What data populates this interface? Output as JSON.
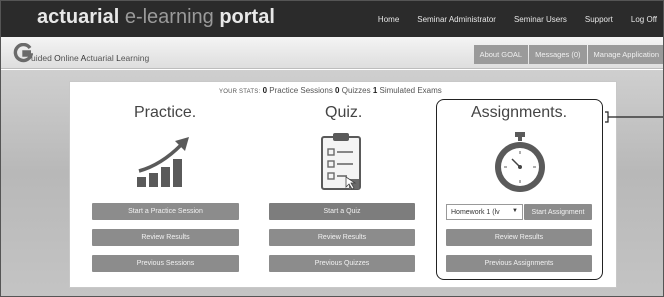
{
  "brand": {
    "part1": "actuarial",
    "part2": " e-learning ",
    "part3": "portal"
  },
  "top_nav": [
    "Home",
    "Seminar Administrator",
    "Seminar Users",
    "Support",
    "Log Off"
  ],
  "logo": {
    "letter": "G",
    "text_parts": [
      "uided ",
      "O",
      "nline ",
      "A",
      "ctuarial ",
      "L",
      "earning"
    ]
  },
  "sub_nav": [
    "About GOAL",
    "Messages (0)",
    "Manage Application"
  ],
  "stats": {
    "label": "YOUR STATS:",
    "sessions_count": "0",
    "sessions_label": " Practice Sessions ",
    "quizzes_count": "0",
    "quizzes_label": " Quizzes ",
    "exams_count": "1",
    "exams_label": " Simulated Exams"
  },
  "practice": {
    "title": "Practice.",
    "start_label": "Start a Practice Session",
    "review_label": "Review Results",
    "previous_label": "Previous Sessions",
    "icon": "rising-bar-chart-icon"
  },
  "quiz": {
    "title": "Quiz.",
    "start_label": "Start a Quiz",
    "review_label": "Review Results",
    "previous_label": "Previous Quizzes",
    "icon": "clipboard-checklist-icon"
  },
  "assignments": {
    "title": "Assignments.",
    "select_value": "Homework 1 (lv",
    "start_label": "Start Assignment",
    "review_label": "Review Results",
    "previous_label": "Previous Assignments",
    "icon": "stopwatch-icon"
  },
  "colors": {
    "topbar": "#2b2b2b",
    "button": "#8c8c8c",
    "highlight_border": "#222222"
  }
}
